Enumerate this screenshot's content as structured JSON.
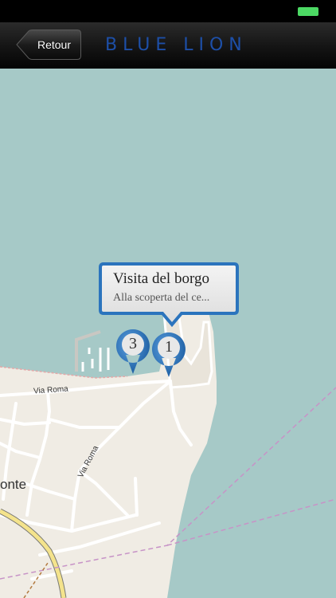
{
  "nav": {
    "back_label": "Retour",
    "title": "BLUE LION"
  },
  "map": {
    "labels": {
      "via_roma_1": "Via Roma",
      "via_roma_2": "Via Roma",
      "onte": "onte"
    },
    "pins": [
      {
        "number": "3",
        "icon": "map-pin-icon"
      },
      {
        "number": "1",
        "icon": "map-pin-icon"
      }
    ],
    "callout": {
      "title": "Visita del borgo",
      "subtitle": "Alla scoperta del ce..."
    }
  },
  "colors": {
    "water": "#a6c9c7",
    "land": "#f0ece4",
    "title": "#1d4fa8",
    "pin": "#2b74bd",
    "battery": "#4cd964"
  }
}
